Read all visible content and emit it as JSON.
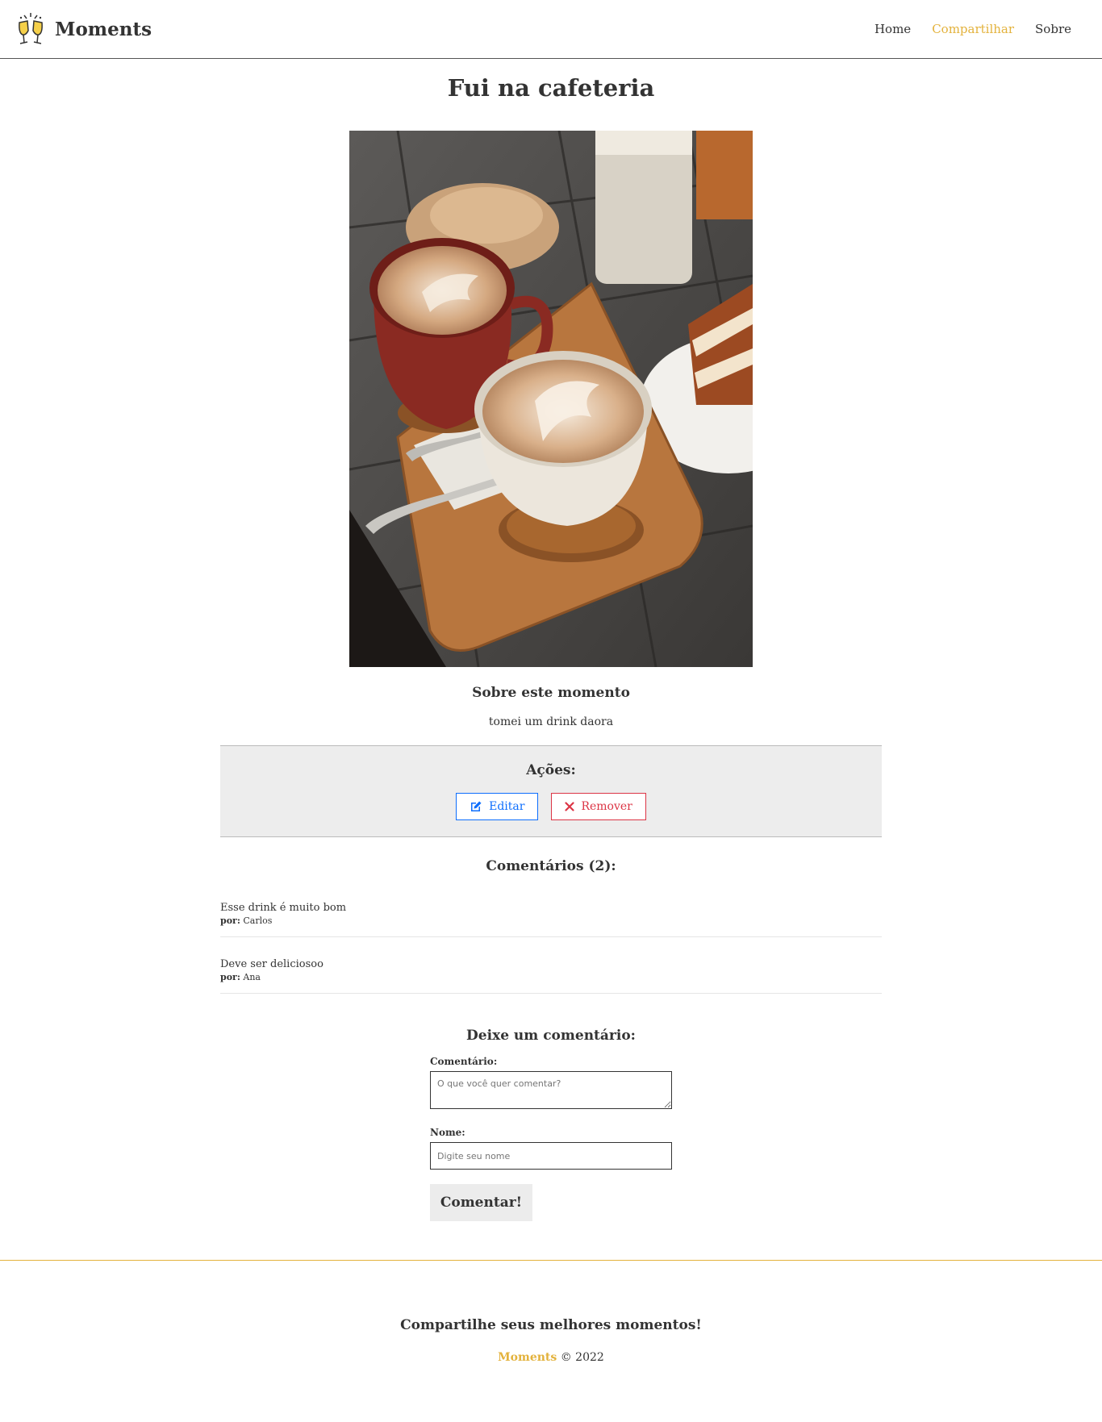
{
  "header": {
    "brand": "Moments",
    "nav": [
      {
        "label": "Home"
      },
      {
        "label": "Compartilhar"
      },
      {
        "label": "Sobre"
      }
    ]
  },
  "moment": {
    "title": "Fui na cafeteria",
    "about_title": "Sobre este momento",
    "description": "tomei um drink daora"
  },
  "actions": {
    "title": "Ações:",
    "edit_label": "Editar",
    "remove_label": "Remover"
  },
  "comments": {
    "title": "Comentários (2):",
    "by_label": "por:",
    "items": [
      {
        "text": "Esse drink é muito bom",
        "author": "Carlos"
      },
      {
        "text": "Deve ser deliciosoo",
        "author": "Ana"
      }
    ]
  },
  "form": {
    "title": "Deixe um comentário:",
    "comment_label": "Comentário:",
    "comment_placeholder": "O que você quer comentar?",
    "name_label": "Nome:",
    "name_placeholder": "Digite seu nome",
    "submit_label": "Comentar!"
  },
  "footer": {
    "tagline": "Compartilhe seus melhores momentos!",
    "brand": "Moments",
    "copyright": "© 2022"
  },
  "colors": {
    "accent": "#e3b23c",
    "edit": "#0d6efd",
    "remove": "#dc3545"
  }
}
